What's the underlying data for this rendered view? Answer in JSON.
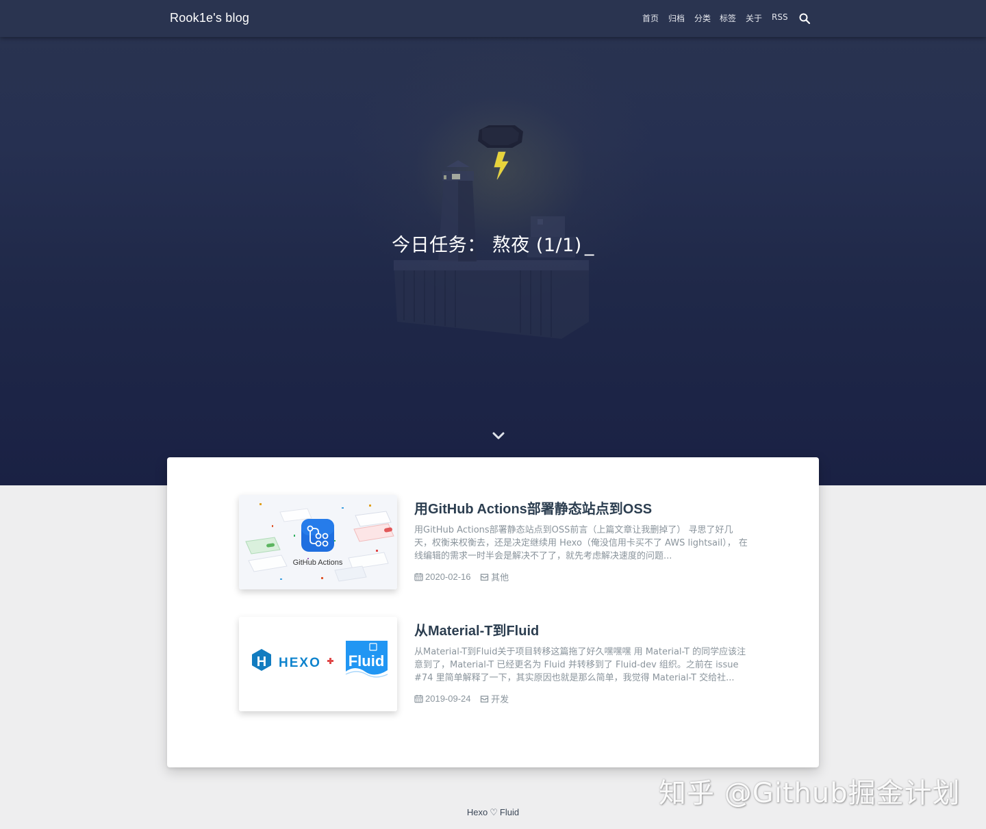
{
  "navbar": {
    "brand": "Rook1e's blog",
    "items": [
      {
        "label": "首页"
      },
      {
        "label": "归档"
      },
      {
        "label": "分类"
      },
      {
        "label": "标签"
      },
      {
        "label": "关于"
      },
      {
        "label": "RSS"
      }
    ],
    "search_icon": "search-icon"
  },
  "hero": {
    "title": "今日任务： 熬夜 (1/1)",
    "cursor": "_",
    "scroll_icon": "chevron-down-icon"
  },
  "posts": [
    {
      "title": "用GitHub Actions部署静态站点到OSS",
      "excerpt": "用GitHub Actions部署静态站点到OSS前言（上篇文章让我删掉了） 寻思了好几天，权衡来权衡去，还是决定继续用 Hexo（俺没信用卡买不了 AWS lightsail）， 在线编辑的需求一时半会是解决不了了，就先考虑解决速度的问题...",
      "date": "2020-02-16",
      "category": "其他",
      "thumb_label": "GitHub Actions"
    },
    {
      "title": "从Material-T到Fluid",
      "excerpt": "从Material-T到Fluid关于项目转移这篇拖了好久嘿嘿嘿 用 Material-T 的同学应该注意到了，Material-T 已经更名为 Fluid 并转移到了 Fluid-dev 组织。之前在 issue #74 里简单解释了一下，其实原因也就是那么简单，我觉得 Material-T 交给社...",
      "date": "2019-09-24",
      "category": "开发",
      "thumb_label_left": "HEXO",
      "thumb_label_right": "Fluid"
    }
  ],
  "footer": {
    "left": "Hexo",
    "heart": "♡",
    "right": "Fluid"
  },
  "watermark": "知乎 @Github掘金计划",
  "colors": {
    "navbar_bg": "#2a3450",
    "hero_bottom": "#1a2144",
    "page_bg": "#eeeeef",
    "title_text": "#2c3e50",
    "muted_text": "#8a949c"
  }
}
